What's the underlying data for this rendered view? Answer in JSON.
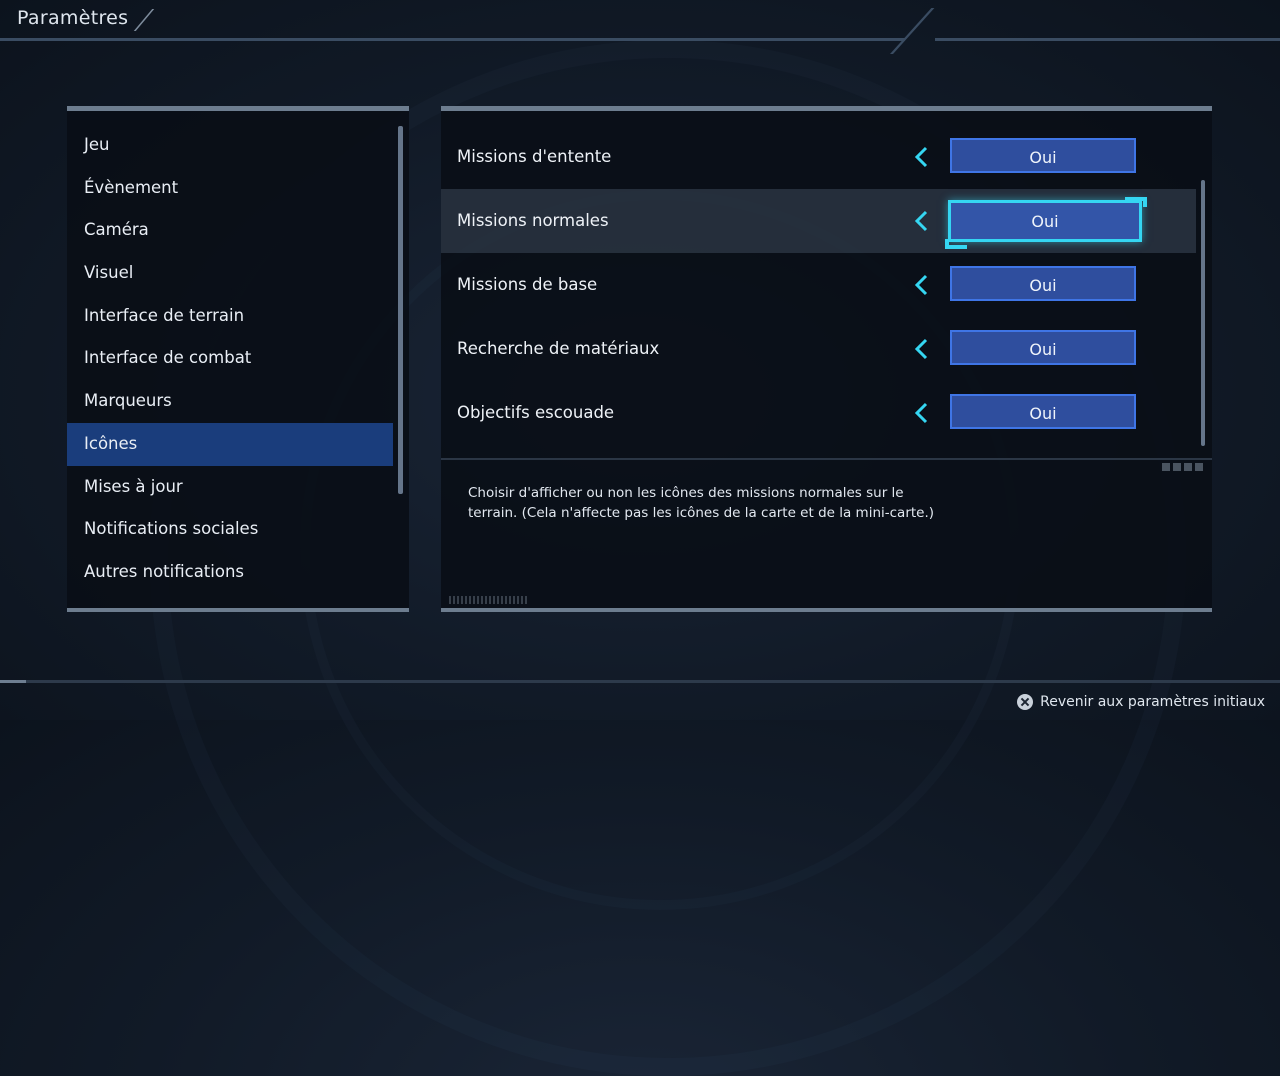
{
  "header": {
    "title": "Paramètres"
  },
  "categories": [
    "Jeu",
    "Évènement",
    "Caméra",
    "Visuel",
    "Interface de terrain",
    "Interface de combat",
    "Marqueurs",
    "Icônes",
    "Mises à jour",
    "Notifications sociales",
    "Autres notifications"
  ],
  "active_category": "Icônes",
  "options": [
    {
      "label": "Missions d'entente",
      "value": "Oui"
    },
    {
      "label": "Missions normales",
      "value": "Oui",
      "selected": true
    },
    {
      "label": "Missions de base",
      "value": "Oui"
    },
    {
      "label": "Recherche de matériaux",
      "value": "Oui"
    },
    {
      "label": "Objectifs escouade",
      "value": "Oui"
    }
  ],
  "description": "Choisir d'afficher ou non les icônes des missions normales sur le terrain. (Cela n'affecte pas les icônes de la carte et de la mini-carte.)",
  "footer": {
    "reset_label": "Revenir aux paramètres initiaux",
    "reset_icon": "cross-button-icon"
  },
  "colors": {
    "accent": "#35d6f2",
    "value_bg": "#2f4e9e",
    "active_category": "#1a3d7c"
  }
}
